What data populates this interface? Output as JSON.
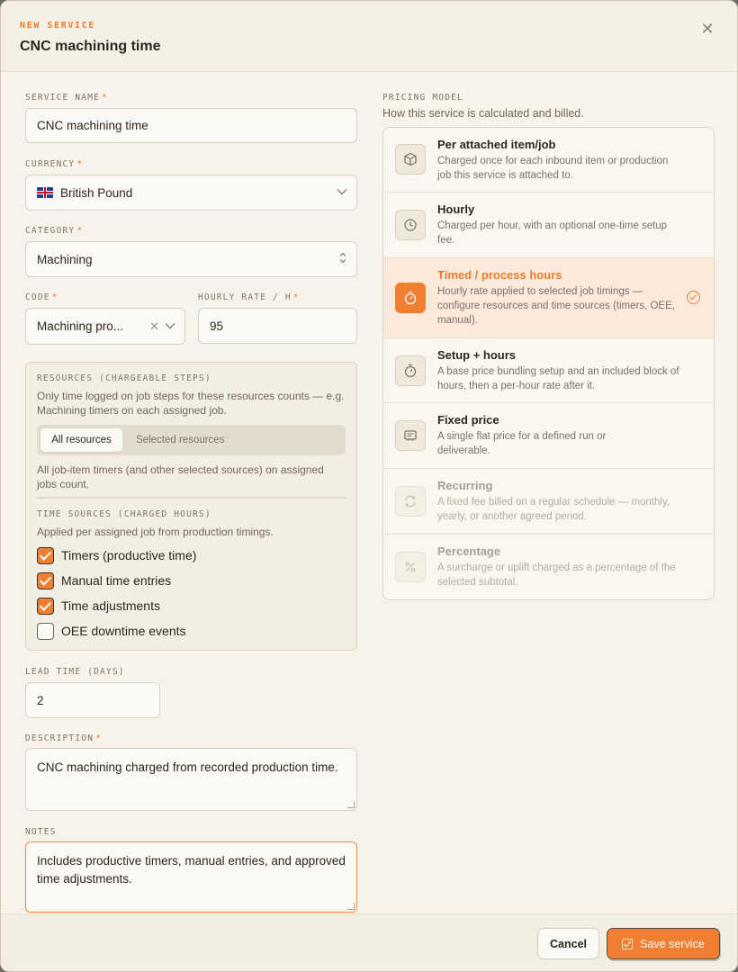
{
  "header": {
    "eyebrow": "NEW SERVICE",
    "title": "CNC machining time",
    "close_icon": "close-icon"
  },
  "form": {
    "service_name": {
      "label": "SERVICE NAME",
      "required": "*",
      "value": "CNC machining time"
    },
    "currency": {
      "label": "CURRENCY",
      "required": "*",
      "value": "British Pound",
      "flag_icon": "uk-flag-icon"
    },
    "category": {
      "label": "CATEGORY",
      "required": "*",
      "value": "Machining"
    },
    "code": {
      "label": "CODE",
      "required": "*",
      "value": "Machining pro..."
    },
    "hourly_rate": {
      "label": "HOURLY RATE / H",
      "required": "*",
      "value": "95"
    },
    "resources": {
      "label": "RESOURCES (CHARGEABLE STEPS)",
      "description": "Only time logged on job steps for these resources counts — e.g. Machining timers on each assigned job.",
      "segments": [
        "All resources",
        "Selected resources"
      ],
      "selected_segment": "All resources",
      "note": "All job-item timers (and other selected sources) on assigned jobs count."
    },
    "time_sources": {
      "label": "TIME SOURCES (CHARGED HOURS)",
      "description": "Applied per assigned job from production timings.",
      "options": [
        {
          "label": "Timers (productive time)",
          "checked": true
        },
        {
          "label": "Manual time entries",
          "checked": true
        },
        {
          "label": "Time adjustments",
          "checked": true
        },
        {
          "label": "OEE downtime events",
          "checked": false
        }
      ]
    },
    "lead_time": {
      "label": "LEAD TIME (DAYS)",
      "value": "2"
    },
    "description": {
      "label": "DESCRIPTION",
      "required": "*",
      "value": "CNC machining charged from recorded production time."
    },
    "notes": {
      "label": "NOTES",
      "value": "Includes productive timers, manual entries, and approved time adjustments."
    }
  },
  "pricing_model": {
    "label": "PRICING MODEL",
    "subtitle": "How this service is calculated and billed.",
    "selected": "Timed / process hours",
    "options": [
      {
        "title": "Per attached item/job",
        "desc": "Charged once for each inbound item or production job this service is attached to.",
        "icon": "box-icon",
        "state": "normal"
      },
      {
        "title": "Hourly",
        "desc": "Charged per hour, with an optional one-time setup fee.",
        "icon": "clock-icon",
        "state": "normal"
      },
      {
        "title": "Timed / process hours",
        "desc": "Hourly rate applied to selected job timings — configure resources and time sources (timers, OEE, manual).",
        "icon": "stopwatch-icon",
        "state": "selected"
      },
      {
        "title": "Setup + hours",
        "desc": "A base price bundling setup and an included block of hours, then a per-hour rate after it.",
        "icon": "timer-icon",
        "state": "normal"
      },
      {
        "title": "Fixed price",
        "desc": "A single flat price for a defined run or deliverable.",
        "icon": "receipt-icon",
        "state": "normal"
      },
      {
        "title": "Recurring",
        "desc": "A fixed fee billed on a regular schedule — monthly, yearly, or another agreed period.",
        "icon": "refresh-icon",
        "state": "disabled"
      },
      {
        "title": "Percentage",
        "desc": "A surcharge or uplift charged as a percentage of the selected subtotal.",
        "icon": "percent-icon",
        "state": "disabled"
      }
    ]
  },
  "footer": {
    "cancel_label": "Cancel",
    "save_label": "Save service"
  },
  "colors": {
    "accent": "#f07f31",
    "background": "#f7f3ea",
    "selected_row": "#fbe9dc"
  }
}
